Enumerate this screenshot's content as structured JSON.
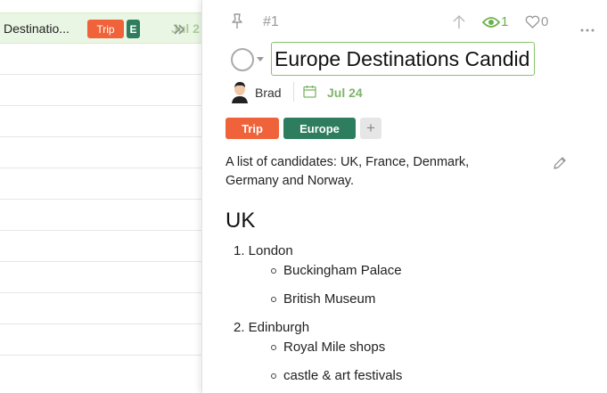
{
  "list": {
    "selected_row": {
      "title": "Destinatio...",
      "tags": [
        "Trip",
        "E"
      ],
      "date": "Jul 2"
    },
    "row_count": 11
  },
  "detail": {
    "task_number": "#1",
    "watchers_count": "1",
    "likes_count": "0",
    "title_value": "Europe Destinations Candid",
    "assignee": "Brad",
    "due_date": "Jul 24",
    "tags": [
      "Trip",
      "Europe"
    ],
    "description": {
      "text": "A list of candidates: UK, France, Denmark, Germany and Norway.",
      "heading": "UK",
      "items": [
        {
          "label": "1. London",
          "children": [
            "Buckingham Palace",
            "British Museum"
          ]
        },
        {
          "label": "2. Edinburgh",
          "children": [
            "Royal Mile shops",
            "castle & art festivals"
          ]
        }
      ]
    }
  },
  "colors": {
    "trip_tag": "#f0623a",
    "europe_tag": "#2e7d5e",
    "accent_green": "#7fb46a",
    "watch_green": "#6bb14a"
  },
  "icons": [
    "collapse-icon",
    "pin-icon",
    "arrow-up-icon",
    "eye-icon",
    "heart-icon",
    "more-icon",
    "calendar-icon",
    "edit-icon"
  ]
}
